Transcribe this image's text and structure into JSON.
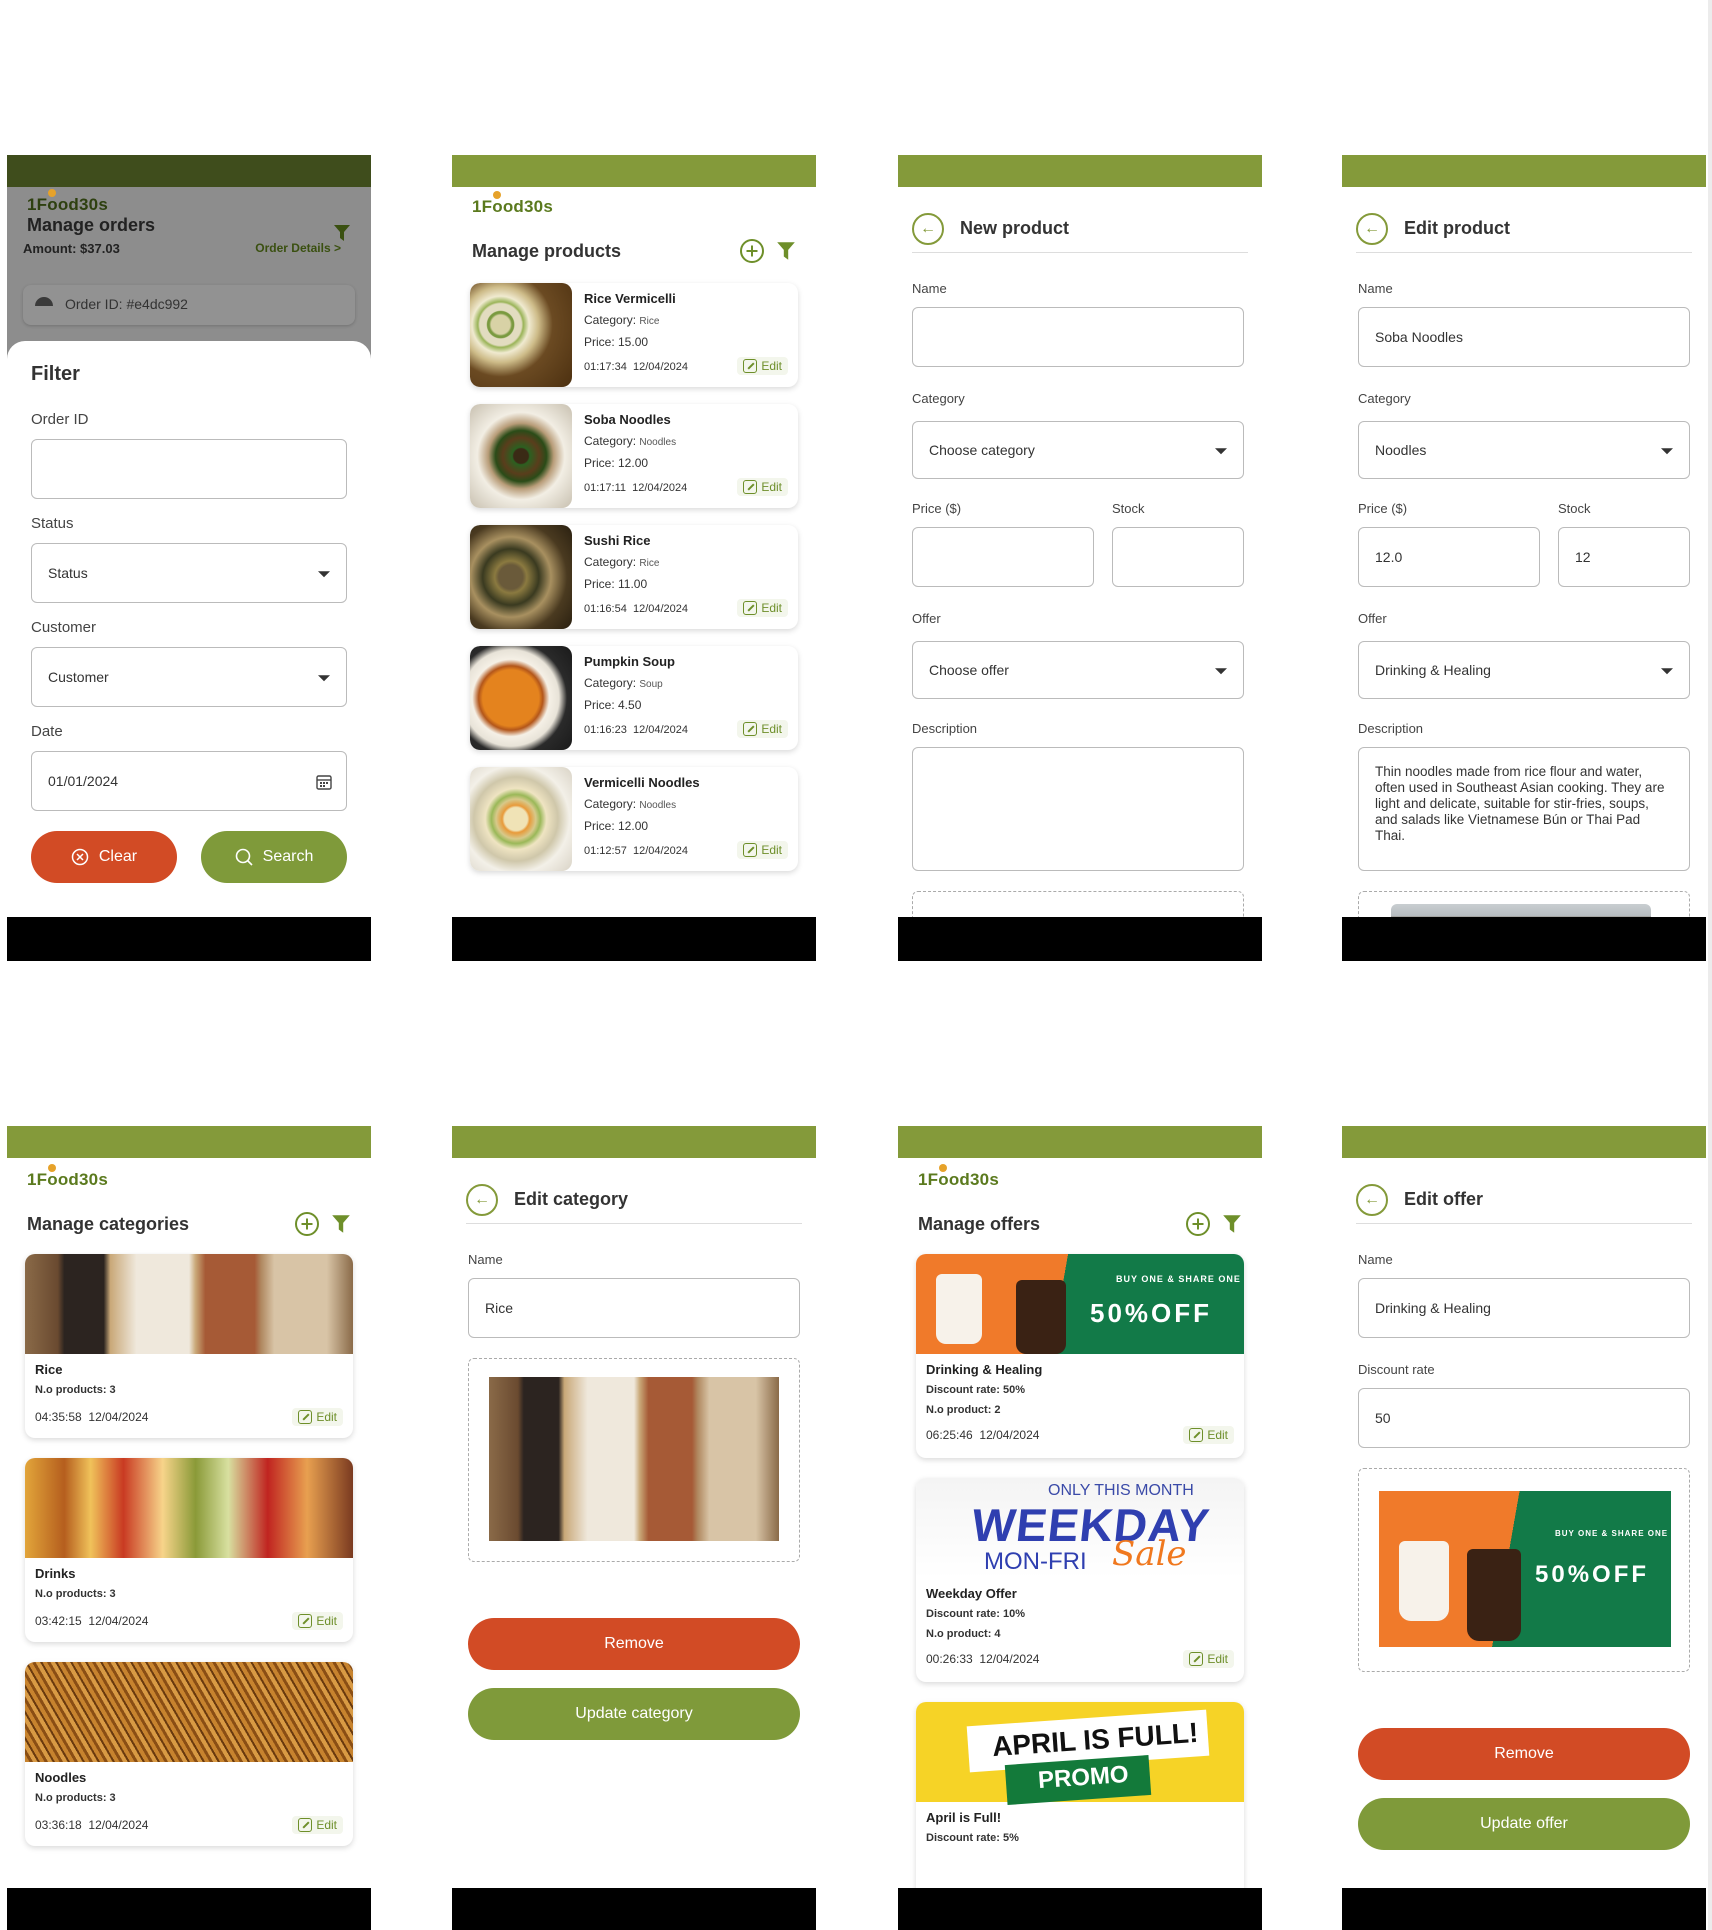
{
  "brand": {
    "logo_text": "1Food30s",
    "accent": "#849a3a",
    "danger": "#d24b25",
    "primary_button": "#7f9a3a"
  },
  "screens": {
    "orders_filter": {
      "bg_title": "Manage orders",
      "amount": "Amount: $37.03",
      "order_details": "Order Details >",
      "order_id_text": "Order ID: #e4dc992",
      "filter_title": "Filter",
      "order_id_label": "Order ID",
      "order_id_value": "",
      "status_label": "Status",
      "status_value": "Status",
      "customer_label": "Customer",
      "customer_value": "Customer",
      "date_label": "Date",
      "date_value": "01/01/2024",
      "clear_label": "Clear",
      "search_label": "Search"
    },
    "products": {
      "title": "Manage products",
      "edit_label": "Edit",
      "items": [
        {
          "name": "Rice Vermicelli",
          "category_label": "Category:",
          "category": "Rice",
          "price": "Price: 15.00",
          "time": "01:17:34",
          "date": "12/04/2024"
        },
        {
          "name": "Soba Noodles",
          "category_label": "Category:",
          "category": "Noodles",
          "price": "Price: 12.00",
          "time": "01:17:11",
          "date": "12/04/2024"
        },
        {
          "name": "Sushi Rice",
          "category_label": "Category:",
          "category": "Rice",
          "price": "Price: 11.00",
          "time": "01:16:54",
          "date": "12/04/2024"
        },
        {
          "name": "Pumpkin Soup",
          "category_label": "Category:",
          "category": "Soup",
          "price": "Price: 4.50",
          "time": "01:16:23",
          "date": "12/04/2024"
        },
        {
          "name": "Vermicelli Noodles",
          "category_label": "Category:",
          "category": "Noodles",
          "price": "Price: 12.00",
          "time": "01:12:57",
          "date": "12/04/2024"
        }
      ]
    },
    "new_product": {
      "title": "New product",
      "name_label": "Name",
      "name_value": "",
      "category_label": "Category",
      "category_value": "Choose category",
      "price_label": "Price ($)",
      "price_value": "",
      "stock_label": "Stock",
      "stock_value": "",
      "offer_label": "Offer",
      "offer_value": "Choose offer",
      "description_label": "Description",
      "description_value": ""
    },
    "edit_product": {
      "title": "Edit product",
      "name_label": "Name",
      "name_value": "Soba Noodles",
      "category_label": "Category",
      "category_value": "Noodles",
      "price_label": "Price ($)",
      "price_value": "12.0",
      "stock_label": "Stock",
      "stock_value": "12",
      "offer_label": "Offer",
      "offer_value": "Drinking & Healing",
      "description_label": "Description",
      "description_value": "Thin noodles made from rice flour and water, often used in Southeast Asian cooking. They are light and delicate, suitable for stir-fries, soups, and salads like Vietnamese Bún or Thai Pad Thai."
    },
    "categories": {
      "title": "Manage categories",
      "edit_label": "Edit",
      "items": [
        {
          "name": "Rice",
          "count": "N.o products: 3",
          "time": "04:35:58",
          "date": "12/04/2024"
        },
        {
          "name": "Drinks",
          "count": "N.o products: 3",
          "time": "03:42:15",
          "date": "12/04/2024"
        },
        {
          "name": "Noodles",
          "count": "N.o products: 3",
          "time": "03:36:18",
          "date": "12/04/2024"
        }
      ]
    },
    "edit_category": {
      "title": "Edit category",
      "name_label": "Name",
      "name_value": "Rice",
      "remove_label": "Remove",
      "update_label": "Update category"
    },
    "offers": {
      "title": "Manage offers",
      "edit_label": "Edit",
      "items": [
        {
          "name": "Drinking & Healing",
          "rate": "Discount rate: 50%",
          "count": "N.o product: 2",
          "time": "06:25:46",
          "date": "12/04/2024",
          "banner": "50%OFF",
          "banner_small": "BUY ONE & SHARE ONE"
        },
        {
          "name": "Weekday Offer",
          "rate": "Discount rate: 10%",
          "count": "N.o product: 4",
          "time": "00:26:33",
          "date": "12/04/2024",
          "banner": "WEEKDAY",
          "banner_small": "ONLY THIS MONTH",
          "banner_sub": "MON-FRI",
          "banner_script": "Sale"
        },
        {
          "name": "April is Full!",
          "rate": "Discount rate: 5%",
          "banner": "APRIL IS FULL!",
          "banner_sub": "PROMO"
        }
      ]
    },
    "edit_offer": {
      "title": "Edit offer",
      "name_label": "Name",
      "name_value": "Drinking & Healing",
      "rate_label": "Discount rate",
      "rate_value": "50",
      "banner": "50%OFF",
      "banner_small": "BUY ONE & SHARE ONE",
      "remove_label": "Remove",
      "update_label": "Update offer"
    }
  }
}
